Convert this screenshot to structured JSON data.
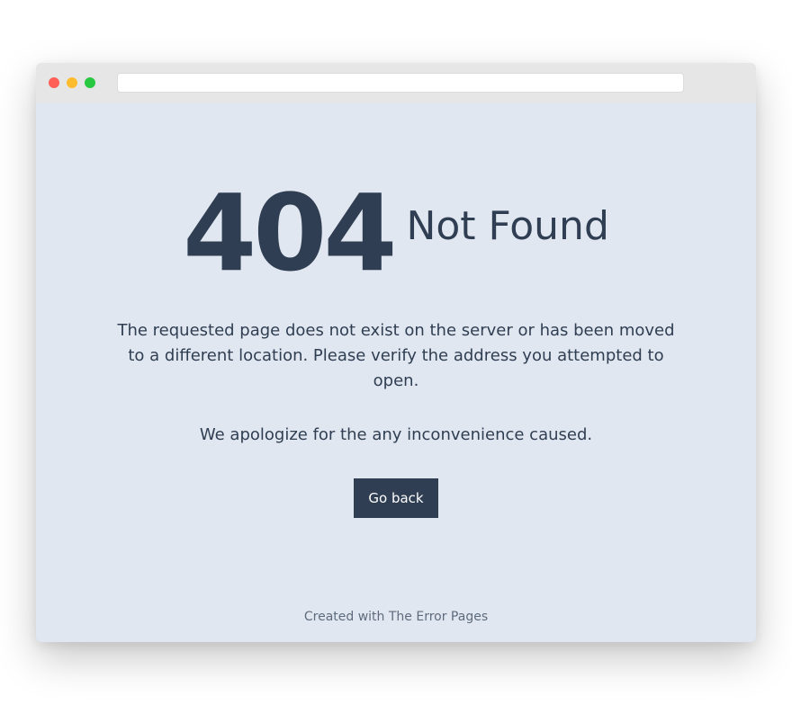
{
  "window": {
    "address_bar_value": ""
  },
  "error": {
    "code": "404",
    "status_text": "Not Found",
    "message": "The requested page does not exist on the server or has been moved to a different location. Please verify the address you attempted to open.",
    "apology": "We apologize for the any inconvenience caused."
  },
  "actions": {
    "go_back_label": "Go back"
  },
  "footer": {
    "credit": "Created with The Error Pages"
  },
  "colors": {
    "page_background": "#e1e7f0",
    "text_primary": "#2f3e52",
    "button_background": "#2f3e52",
    "button_text": "#ffffff",
    "footer_text": "#5e6b7d",
    "traffic_close": "#fe5f57",
    "traffic_minimize": "#febc2e",
    "traffic_maximize": "#28c840"
  }
}
